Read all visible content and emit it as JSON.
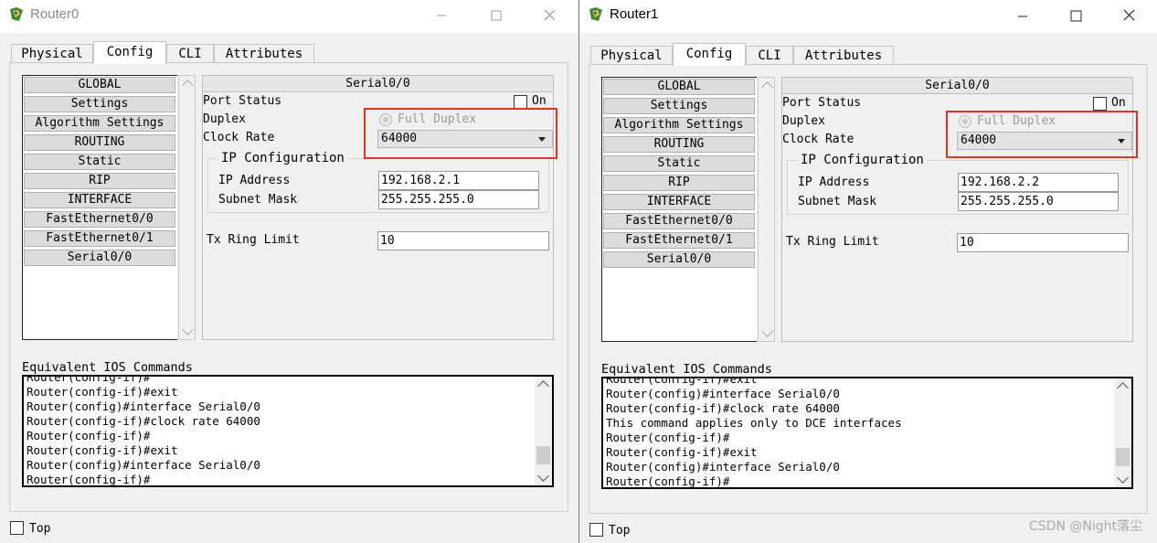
{
  "windows": [
    {
      "title": "Router0",
      "tabs": [
        "Physical",
        "Config",
        "CLI",
        "Attributes"
      ],
      "active_tab": "Config",
      "nav_items": [
        "GLOBAL",
        "Settings",
        "Algorithm Settings",
        "ROUTING",
        "Static",
        "RIP",
        "INTERFACE",
        "FastEthernet0/0",
        "FastEthernet0/1",
        "Serial0/0"
      ],
      "interface": {
        "header": "Serial0/0",
        "port_status_label": "Port Status",
        "on_label": "On",
        "duplex_label": "Duplex",
        "full_duplex_label": "Full Duplex",
        "clock_rate_label": "Clock Rate",
        "clock_rate_value": "64000",
        "ip_config_legend": "IP Configuration",
        "ip_address_label": "IP Address",
        "ip_address_value": "192.168.2.1",
        "subnet_mask_label": "Subnet Mask",
        "subnet_mask_value": "255.255.255.0",
        "tx_ring_limit_label": "Tx Ring Limit",
        "tx_ring_limit_value": "10"
      },
      "ios_commands_label": "Equivalent IOS Commands",
      "ios_lines": [
        "Router(config-if)#",
        "Router(config-if)#exit",
        "Router(config)#interface Serial0/0",
        "Router(config-if)#clock rate 64000",
        "Router(config-if)#",
        "Router(config-if)#exit",
        "Router(config)#interface Serial0/0",
        "Router(config-if)#"
      ],
      "top_label": "Top"
    },
    {
      "title": "Router1",
      "tabs": [
        "Physical",
        "Config",
        "CLI",
        "Attributes"
      ],
      "active_tab": "Config",
      "nav_items": [
        "GLOBAL",
        "Settings",
        "Algorithm Settings",
        "ROUTING",
        "Static",
        "RIP",
        "INTERFACE",
        "FastEthernet0/0",
        "FastEthernet0/1",
        "Serial0/0"
      ],
      "interface": {
        "header": "Serial0/0",
        "port_status_label": "Port Status",
        "on_label": "On",
        "duplex_label": "Duplex",
        "full_duplex_label": "Full Duplex",
        "clock_rate_label": "Clock Rate",
        "clock_rate_value": "64000",
        "ip_config_legend": "IP Configuration",
        "ip_address_label": "IP Address",
        "ip_address_value": "192.168.2.2",
        "subnet_mask_label": "Subnet Mask",
        "subnet_mask_value": "255.255.255.0",
        "tx_ring_limit_label": "Tx Ring Limit",
        "tx_ring_limit_value": "10"
      },
      "ios_commands_label": "Equivalent IOS Commands",
      "ios_lines": [
        "Router(config-if)#exit",
        "Router(config)#interface Serial0/0",
        "Router(config-if)#clock rate 64000",
        "This command applies only to DCE interfaces",
        "Router(config-if)#",
        "Router(config-if)#exit",
        "Router(config)#interface Serial0/0",
        "Router(config-if)#"
      ],
      "top_label": "Top"
    }
  ],
  "watermark": "CSDN @Night落尘",
  "colors": {
    "highlight": "#e8321f"
  }
}
